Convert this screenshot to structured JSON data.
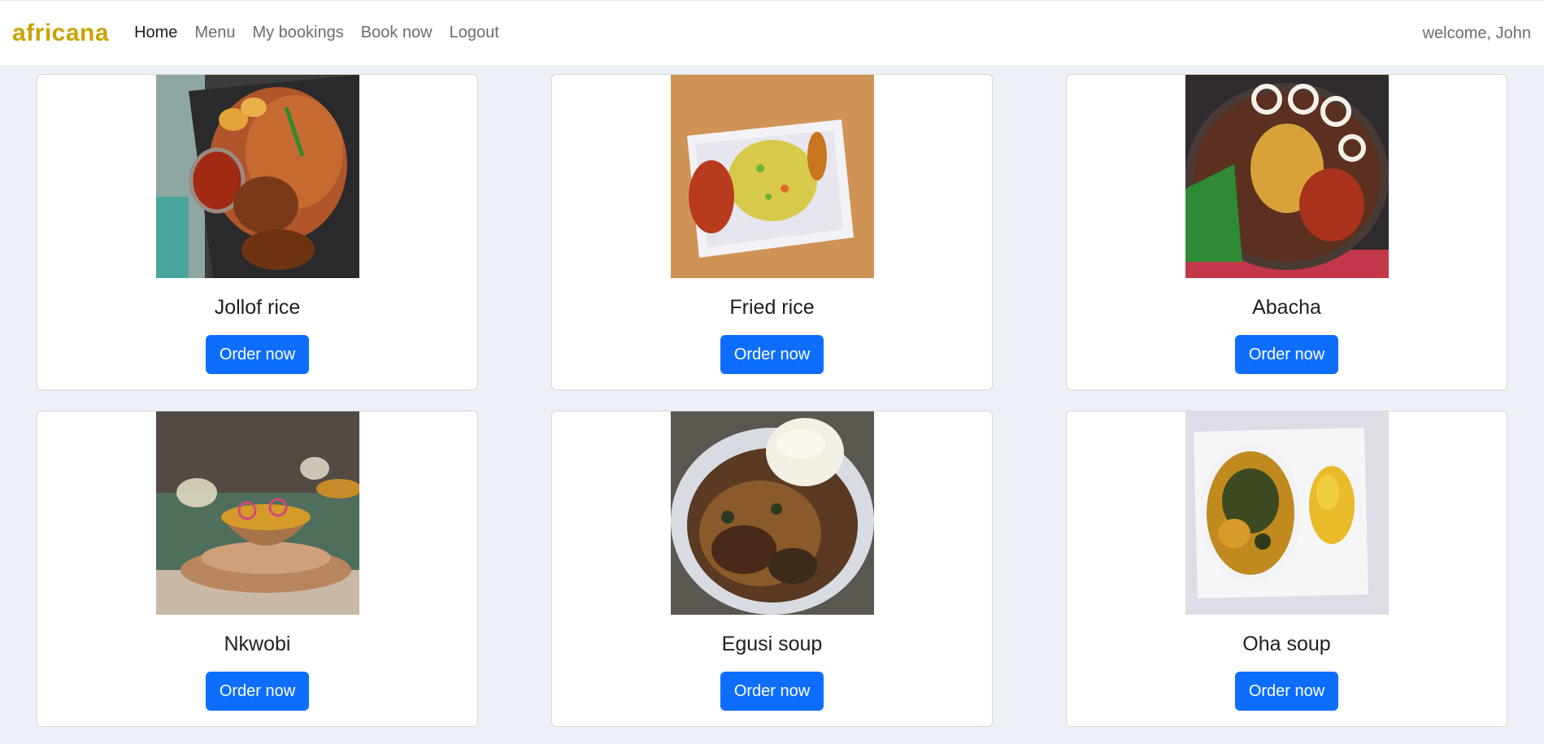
{
  "navbar": {
    "brand": "africana",
    "links": [
      {
        "label": "Home"
      },
      {
        "label": "Menu"
      },
      {
        "label": "My bookings"
      },
      {
        "label": "Book now"
      },
      {
        "label": "Logout"
      }
    ],
    "welcome": "welcome, John"
  },
  "dishes": [
    {
      "name": "Jollof rice",
      "button": "Order now"
    },
    {
      "name": "Fried rice",
      "button": "Order now"
    },
    {
      "name": "Abacha",
      "button": "Order now"
    },
    {
      "name": "Nkwobi",
      "button": "Order now"
    },
    {
      "name": "Egusi soup",
      "button": "Order now"
    },
    {
      "name": "Oha soup",
      "button": "Order now"
    }
  ],
  "colors": {
    "brand": "#c9a400",
    "primary_button": "#0d6efd",
    "page_background": "#eef0f8"
  }
}
